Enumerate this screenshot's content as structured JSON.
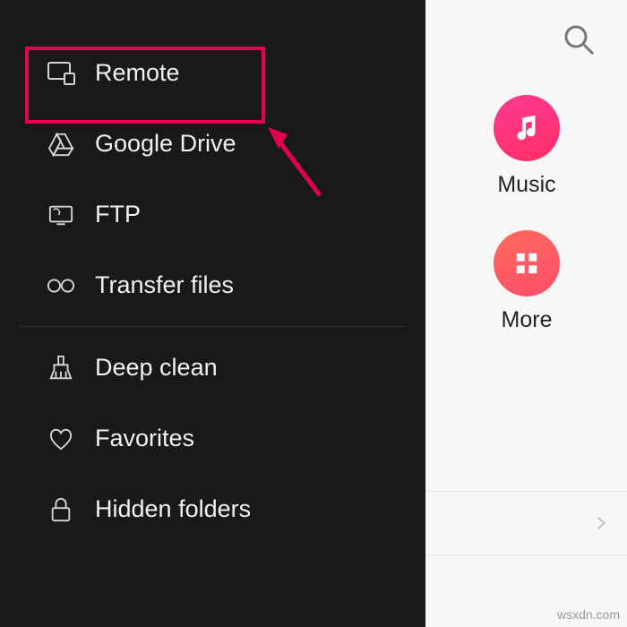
{
  "sidebar": {
    "items": [
      {
        "label": "Remote",
        "icon": "monitor-icon"
      },
      {
        "label": "Google Drive",
        "icon": "drive-icon"
      },
      {
        "label": "FTP",
        "icon": "ftp-icon"
      },
      {
        "label": "Transfer files",
        "icon": "link-icon"
      },
      {
        "label": "Deep clean",
        "icon": "broom-icon"
      },
      {
        "label": "Favorites",
        "icon": "heart-icon"
      },
      {
        "label": "Hidden folders",
        "icon": "lock-icon"
      }
    ]
  },
  "main": {
    "tiles": [
      {
        "label": "Music",
        "icon": "music-icon"
      },
      {
        "label": "More",
        "icon": "grid-icon"
      }
    ]
  },
  "annotations": {
    "highlight_color": "#e2004f",
    "arrow_color": "#e2004f"
  },
  "watermark": "wsxdn.com"
}
